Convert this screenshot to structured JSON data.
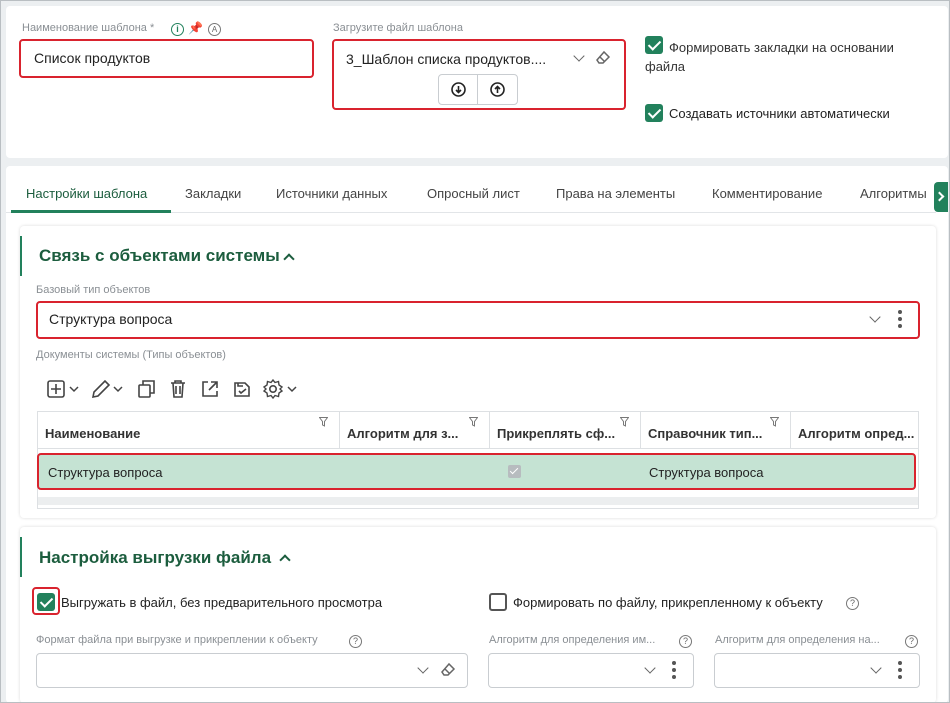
{
  "top": {
    "template_name_label": "Наименование шаблона *",
    "template_name_value": "Список продуктов",
    "upload_label": "Загрузите файл шаблона",
    "file_name": "3_Шаблон списка продуктов....",
    "checkbox_bookmarks": "Формировать закладки на основании файла",
    "checkbox_sources": "Создавать источники автоматически"
  },
  "tabs": [
    "Настройки шаблона",
    "Закладки",
    "Источники данных",
    "Опросный лист",
    "Права на элементы",
    "Комментирование",
    "Алгоритмы"
  ],
  "link_section": {
    "title": "Связь с объектами системы",
    "base_type_label": "Базовый тип объектов",
    "base_type_value": "Структура вопроса",
    "docs_label": "Документы системы (Типы объектов)",
    "columns": [
      "Наименование",
      "Алгоритм для з...",
      "Прикреплять сф...",
      "Справочник тип...",
      "Алгоритм опред..."
    ],
    "row": {
      "name": "Структура вопроса",
      "attach_checked": true,
      "reference": "Структура вопроса"
    }
  },
  "export_section": {
    "title": "Настройка выгрузки файла",
    "cb_export_label": "Выгружать в файл, без предварительного просмотра",
    "cb_form_label": "Формировать по файлу, прикрепленному к объекту",
    "format_label": "Формат файла при выгрузке и прикреплении к объекту",
    "algo_name_label": "Алгоритм для определения им...",
    "algo_na_label": "Алгоритм для определения на..."
  },
  "colors": {
    "accent": "#22815c",
    "highlight_row": "#c5e3d3",
    "red_outline": "#d9232e"
  }
}
